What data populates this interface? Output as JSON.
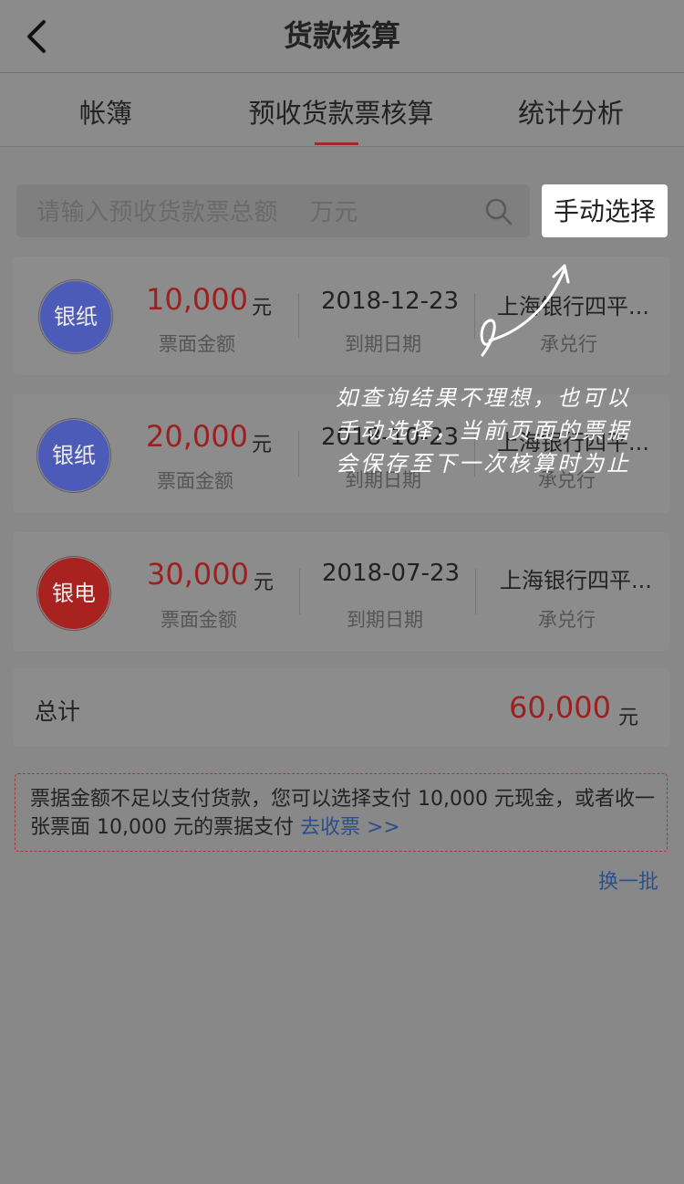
{
  "header": {
    "title": "货款核算",
    "back_icon": "chevron-left-icon"
  },
  "tabs": [
    {
      "label": "帐簿"
    },
    {
      "label": "预收货款票核算",
      "active": true
    },
    {
      "label": "统计分析"
    }
  ],
  "search": {
    "placeholder": "请输入预收货款票总额    万元",
    "icon": "search-icon"
  },
  "manual_select_label": "手动选择",
  "tickets": [
    {
      "type": "银纸",
      "badge_color": "#4d5bb8",
      "amount": "10,000",
      "unit": "元",
      "amount_label": "票面金额",
      "due_date": "2018-12-23",
      "due_label": "到期日期",
      "bank": "上海银行四平...",
      "bank_label": "承兑行"
    },
    {
      "type": "银纸",
      "badge_color": "#4d5bb8",
      "amount": "20,000",
      "unit": "元",
      "amount_label": "票面金额",
      "due_date": "2018-10-23",
      "due_label": "到期日期",
      "bank": "上海银行四平...",
      "bank_label": "承兑行"
    },
    {
      "type": "银电",
      "badge_color": "#a8221f",
      "amount": "30,000",
      "unit": "元",
      "amount_label": "票面金额",
      "due_date": "2018-07-23",
      "due_label": "到期日期",
      "bank": "上海银行四平...",
      "bank_label": "承兑行"
    }
  ],
  "total": {
    "label": "总计",
    "amount": "60,000",
    "unit": "元"
  },
  "notice": {
    "text": "票据金额不足以支付货款，您可以选择支付 10,000 元现金，或者收一张票面 10,000 元的票据支付 ",
    "link": "去收票 >>"
  },
  "swap_label": "换一批",
  "annotation": {
    "text": "如查询结果不理想，也可以手动选择，当前页面的票据会保存至下一次核算时为止"
  },
  "colors": {
    "amount_red": "#9d2020",
    "link_blue": "#2b4f8a",
    "active_tab": "#a02a2a"
  }
}
